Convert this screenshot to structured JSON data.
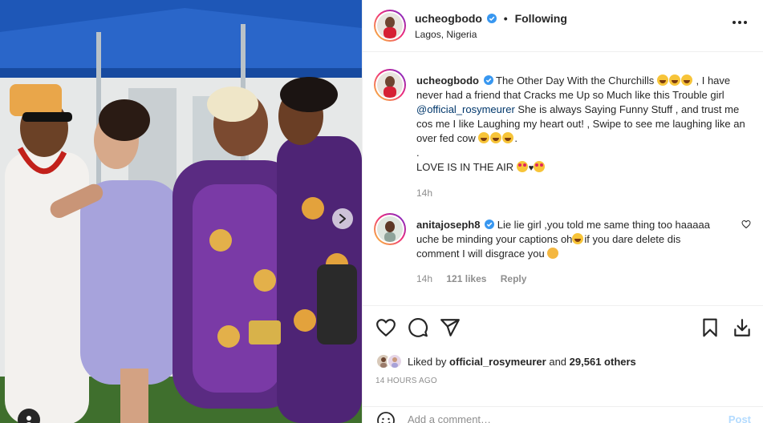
{
  "post_header": {
    "username": "ucheogbodo",
    "verified": true,
    "separator": "•",
    "follow_status": "Following",
    "location": "Lagos, Nigeria"
  },
  "caption": {
    "username": "ucheogbodo",
    "text_part1": "The Other Day With the Churchills",
    "text_part2": ", I have never had a friend that Cracks me Up so Much like this Trouble girl",
    "mention": "@official_rosymeurer",
    "text_part3": "She is always Saying Funny Stuff , and trust me cos me I like Laughing my heart out! , Swipe to see me laughing like an over fed cow",
    "dot_line": ".",
    "love_line": "LOVE IS IN THE AIR",
    "time": "14h"
  },
  "comment": {
    "username": "anitajoseph8",
    "text": "Lie lie girl ,you told me same thing too haaaaa uche be minding your captions oh",
    "text_part2": "if you dare delete dis comment I will disgrace you",
    "time": "14h",
    "likes": "121 likes",
    "reply": "Reply"
  },
  "likes": {
    "prefix": "Liked by",
    "user": "official_rosymeurer",
    "joiner": "and",
    "count": "29,561 others"
  },
  "timestamp": "14 HOURS AGO",
  "add_comment": {
    "placeholder": "Add a comment…",
    "post_label": "Post"
  },
  "icons": {
    "more": "more-options-icon",
    "heart": "heart-icon",
    "comment": "comment-icon",
    "share": "share-icon",
    "save": "bookmark-icon",
    "download": "download-icon",
    "next": "chevron-right-icon",
    "tag": "person-tag-icon",
    "emoji": "smiley-icon"
  },
  "colors": {
    "verified": "#3897f0",
    "mention": "#00376b",
    "post_disabled": "#b3dbff",
    "secondary_text": "#8e8e8e"
  }
}
